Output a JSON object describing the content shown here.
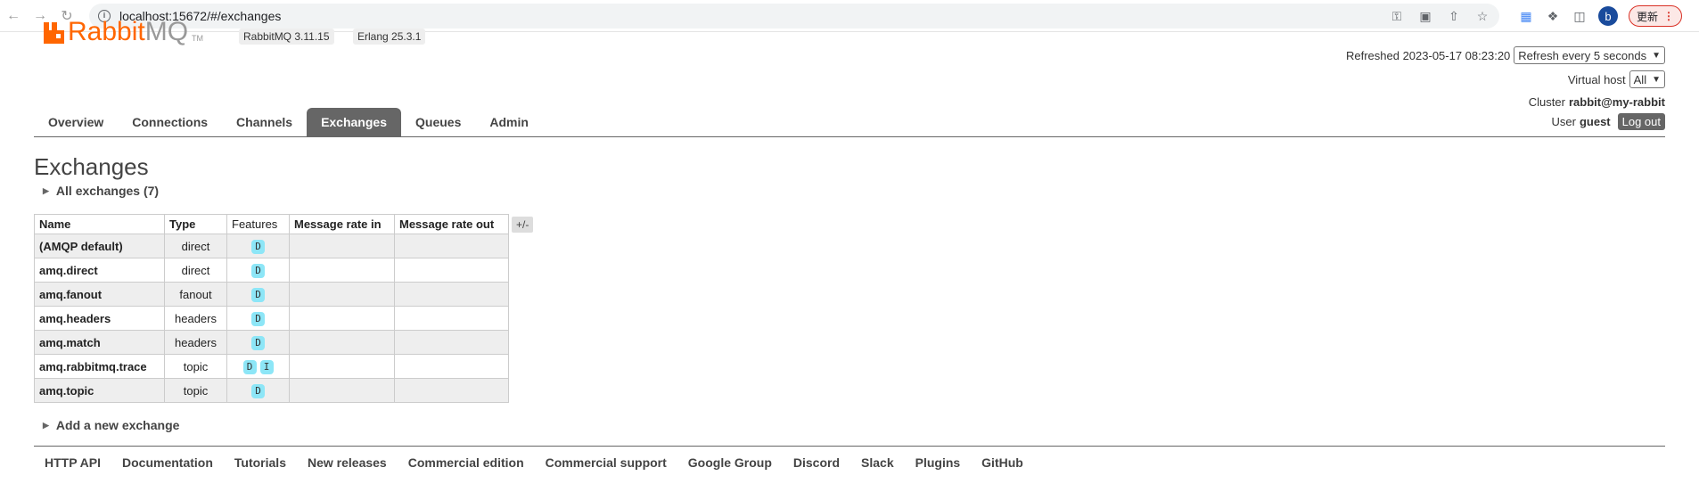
{
  "browser": {
    "url": "localhost:15672/#/exchanges",
    "update_label": "更新",
    "profile_initial": "b"
  },
  "logo": {
    "rabbit": "Rabbit",
    "mq": "MQ",
    "tm": "TM"
  },
  "versions": {
    "rabbitmq": "RabbitMQ 3.11.15",
    "erlang": "Erlang 25.3.1"
  },
  "status": {
    "refreshed_label": "Refreshed 2023-05-17 08:23:20",
    "refresh_select": "Refresh every 5 seconds",
    "vhost_label": "Virtual host",
    "vhost_select": "All",
    "cluster_label": "Cluster",
    "cluster_name": "rabbit@my-rabbit",
    "user_label": "User",
    "user_name": "guest",
    "logout_label": "Log out"
  },
  "tabs": [
    {
      "label": "Overview"
    },
    {
      "label": "Connections"
    },
    {
      "label": "Channels"
    },
    {
      "label": "Exchanges",
      "active": true
    },
    {
      "label": "Queues"
    },
    {
      "label": "Admin"
    }
  ],
  "page_title": "Exchanges",
  "all_exchanges_label": "All exchanges (7)",
  "table": {
    "headers": {
      "name": "Name",
      "type": "Type",
      "features": "Features",
      "rate_in": "Message rate in",
      "rate_out": "Message rate out"
    },
    "plus_minus": "+/-",
    "rows": [
      {
        "name": "(AMQP default)",
        "type": "direct",
        "features": [
          "D"
        ],
        "rate_in": "",
        "rate_out": ""
      },
      {
        "name": "amq.direct",
        "type": "direct",
        "features": [
          "D"
        ],
        "rate_in": "",
        "rate_out": ""
      },
      {
        "name": "amq.fanout",
        "type": "fanout",
        "features": [
          "D"
        ],
        "rate_in": "",
        "rate_out": ""
      },
      {
        "name": "amq.headers",
        "type": "headers",
        "features": [
          "D"
        ],
        "rate_in": "",
        "rate_out": ""
      },
      {
        "name": "amq.match",
        "type": "headers",
        "features": [
          "D"
        ],
        "rate_in": "",
        "rate_out": ""
      },
      {
        "name": "amq.rabbitmq.trace",
        "type": "topic",
        "features": [
          "D",
          "I"
        ],
        "rate_in": "",
        "rate_out": ""
      },
      {
        "name": "amq.topic",
        "type": "topic",
        "features": [
          "D"
        ],
        "rate_in": "",
        "rate_out": ""
      }
    ]
  },
  "add_exchange_label": "Add a new exchange",
  "footer": [
    "HTTP API",
    "Documentation",
    "Tutorials",
    "New releases",
    "Commercial edition",
    "Commercial support",
    "Google Group",
    "Discord",
    "Slack",
    "Plugins",
    "GitHub"
  ],
  "colors": {
    "brand_orange": "#ff6600",
    "tab_active": "#666666",
    "feature_badge": "#8de6f7"
  }
}
